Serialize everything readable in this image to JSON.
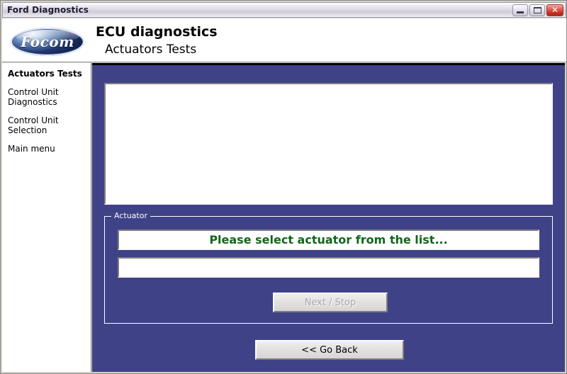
{
  "window": {
    "title": "Ford Diagnostics",
    "controls": {
      "minimize_label": "Minimize",
      "maximize_label": "Maximize",
      "close_label": "✕"
    }
  },
  "header": {
    "logo_text": "Focom",
    "title": "ECU diagnostics",
    "subtitle": "Actuators Tests"
  },
  "sidebar": {
    "items": [
      {
        "label": "Actuators Tests",
        "active": true
      },
      {
        "label": "Control Unit Diagnostics",
        "active": false
      },
      {
        "label": "Control Unit Selection",
        "active": false
      },
      {
        "label": "Main menu",
        "active": false
      }
    ]
  },
  "main": {
    "list_box": {
      "items": []
    },
    "group": {
      "legend": "Actuator",
      "status_text": "Please select actuator from the list...",
      "value_text": "",
      "next_button": {
        "label": "Next / Stop",
        "enabled": false
      }
    },
    "back_button": {
      "label": "<< Go Back",
      "enabled": true
    }
  },
  "colors": {
    "panel_blue": "#3f4287",
    "status_green": "#11661a",
    "titlebar_text": "#1b1b33",
    "close_red": "#c33024"
  }
}
